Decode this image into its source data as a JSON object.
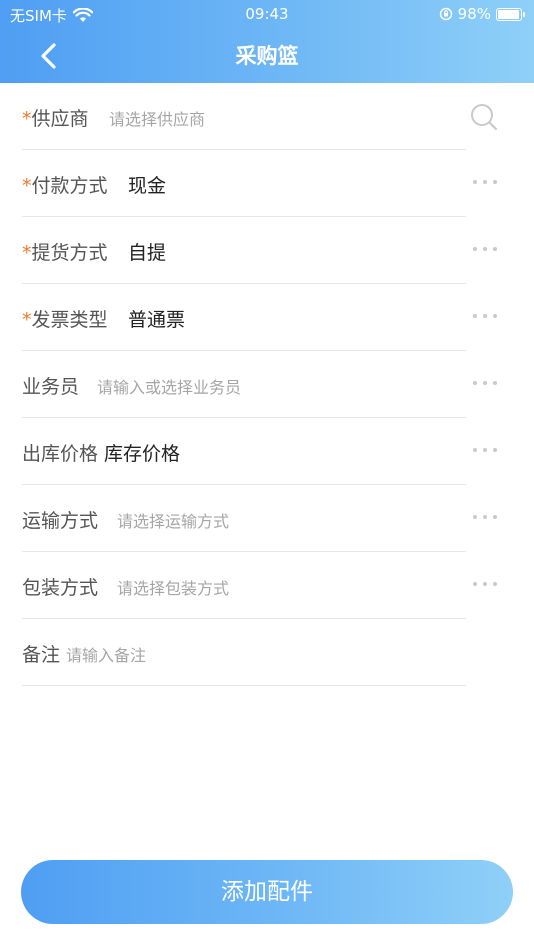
{
  "status_bar": {
    "carrier": "无SIM卡",
    "time": "09:43",
    "battery": "98%",
    "battery_level": 0.98
  },
  "nav": {
    "title": "采购篮"
  },
  "form": {
    "supplier": {
      "label": "供应商",
      "required": "*",
      "placeholder": "请选择供应商"
    },
    "payment": {
      "label": "付款方式",
      "required": "*",
      "value": "现金"
    },
    "pickup": {
      "label": "提货方式",
      "required": "*",
      "value": "自提"
    },
    "invoice": {
      "label": "发票类型",
      "required": "*",
      "value": "普通票"
    },
    "salesperson": {
      "label": "业务员",
      "placeholder": "请输入或选择业务员"
    },
    "price": {
      "label": "出库价格",
      "value": "库存价格"
    },
    "transport": {
      "label": "运输方式",
      "placeholder": "请选择运输方式"
    },
    "packaging": {
      "label": "包装方式",
      "placeholder": "请选择包装方式"
    },
    "remark": {
      "label": "备注",
      "placeholder": "请输入备注"
    }
  },
  "actions": {
    "add_parts": "添加配件"
  },
  "colors": {
    "accent_start": "#4f9ef3",
    "accent_end": "#8fd0f8",
    "required": "#f07a2a"
  }
}
